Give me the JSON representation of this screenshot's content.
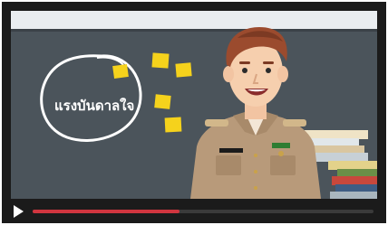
{
  "video": {
    "overlay_text": "แรงบันดาลใจ",
    "progress_fraction": 0.43
  },
  "controls": {
    "play_icon": "play-icon"
  },
  "colors": {
    "player_bg": "#1b1b1b",
    "chalkboard": "#4b545b",
    "wall": "#e9edf0",
    "progress": "#d0353f",
    "sticky_note": "#f5d21c",
    "uniform": "#b89a7a"
  }
}
